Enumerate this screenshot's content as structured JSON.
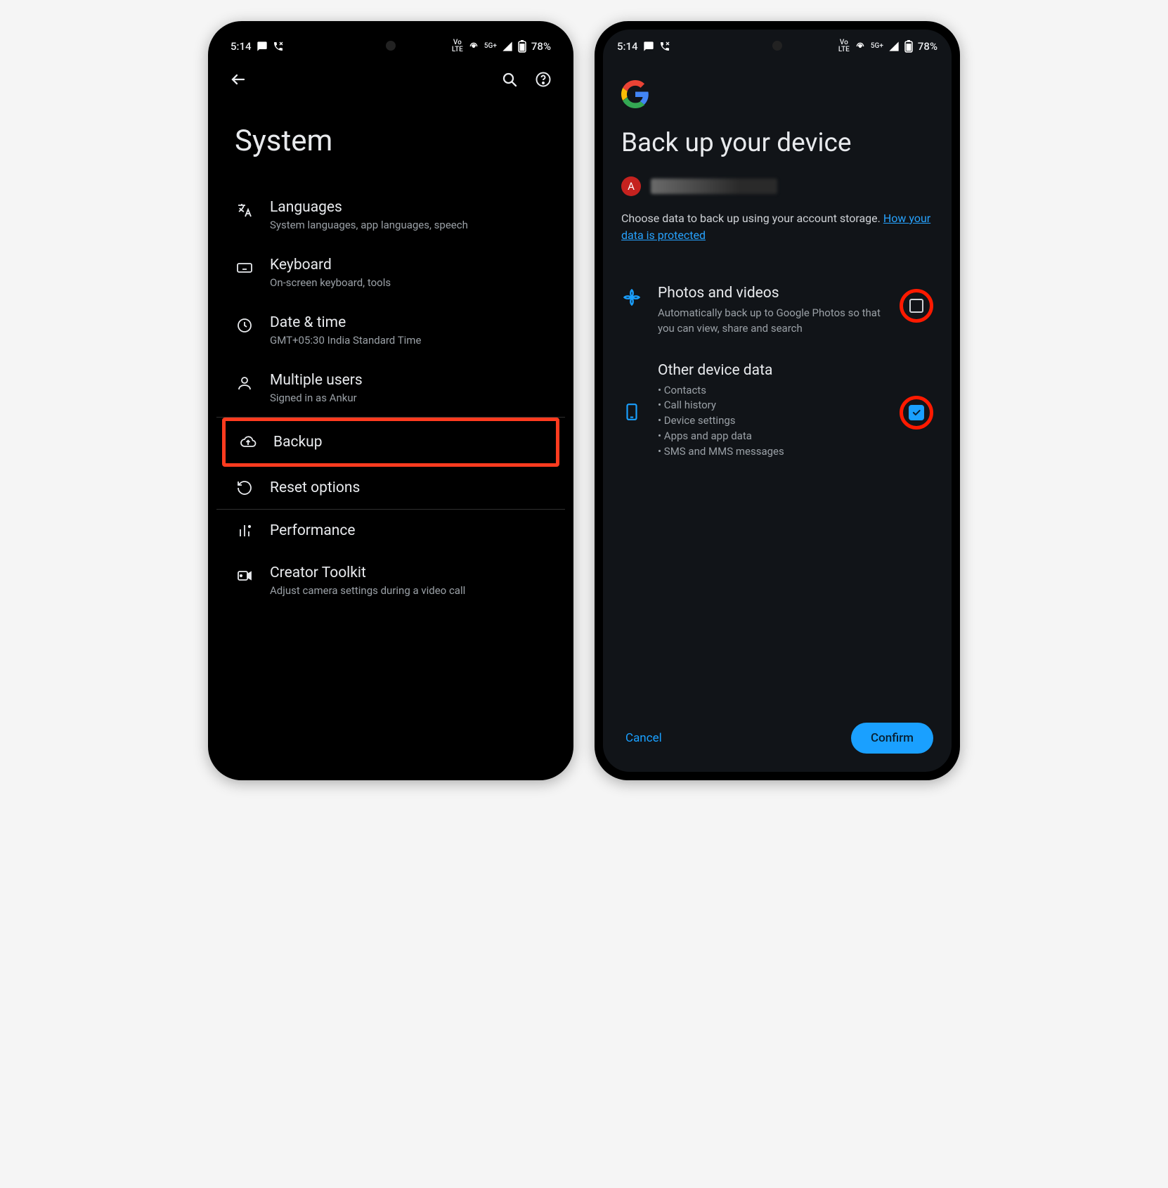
{
  "status": {
    "time": "5:14",
    "volte": "Vo\nLTE",
    "net": "5G+",
    "battery": "78%"
  },
  "screen1": {
    "title": "System",
    "items": [
      {
        "title": "Languages",
        "sub": "System languages, app languages, speech"
      },
      {
        "title": "Keyboard",
        "sub": "On-screen keyboard, tools"
      },
      {
        "title": "Date & time",
        "sub": "GMT+05:30 India Standard Time"
      },
      {
        "title": "Multiple users",
        "sub": "Signed in as Ankur"
      },
      {
        "title": "Backup",
        "sub": ""
      },
      {
        "title": "Reset options",
        "sub": ""
      },
      {
        "title": "Performance",
        "sub": ""
      },
      {
        "title": "Creator Toolkit",
        "sub": "Adjust camera settings during a video call"
      }
    ]
  },
  "screen2": {
    "headline": "Back up your device",
    "avatar_letter": "A",
    "desc_text": "Choose data to back up using your account storage. ",
    "desc_link": "How your data is protected",
    "option1": {
      "title": "Photos and videos",
      "sub": "Automatically back up to Google Photos so that you can view, share and search"
    },
    "option2": {
      "title": "Other device data",
      "bullets": [
        "Contacts",
        "Call history",
        "Device settings",
        "Apps and app data",
        "SMS and MMS messages"
      ]
    },
    "cancel": "Cancel",
    "confirm": "Confirm"
  }
}
